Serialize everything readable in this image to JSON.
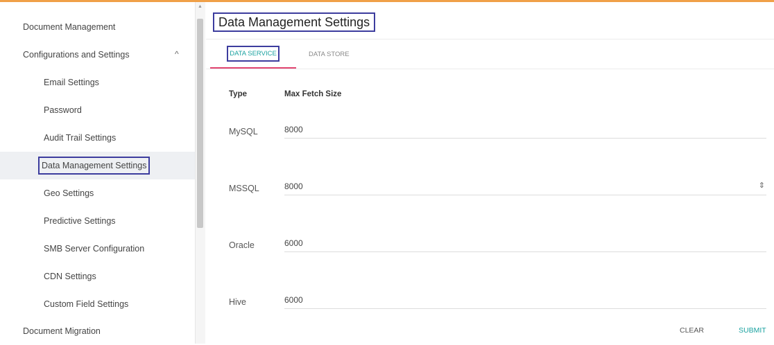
{
  "sidebar": {
    "items": [
      {
        "label": "Document Management"
      },
      {
        "label": "Configurations and Settings"
      },
      {
        "label": "Email Settings"
      },
      {
        "label": "Password"
      },
      {
        "label": "Audit Trail Settings"
      },
      {
        "label": "Data Management Settings"
      },
      {
        "label": "Geo Settings"
      },
      {
        "label": "Predictive Settings"
      },
      {
        "label": "SMB Server Configuration"
      },
      {
        "label": "CDN Settings"
      },
      {
        "label": "Custom Field Settings"
      },
      {
        "label": "Document Migration"
      }
    ],
    "chevron": "^"
  },
  "main": {
    "title": "Data Management Settings",
    "tabs": [
      {
        "label": "DATA SERVICE"
      },
      {
        "label": "DATA STORE"
      }
    ],
    "headers": {
      "type": "Type",
      "max_fetch": "Max Fetch Size"
    },
    "rows": [
      {
        "type": "MySQL",
        "value": "8000"
      },
      {
        "type": "MSSQL",
        "value": "8000"
      },
      {
        "type": "Oracle",
        "value": "6000"
      },
      {
        "type": "Hive",
        "value": "6000"
      }
    ],
    "spinner": "⇕",
    "buttons": {
      "clear": "CLEAR",
      "submit": "SUBMIT"
    }
  },
  "colors": {
    "accent": "#1aa2a0",
    "tab_underline": "#e0436f",
    "highlight_box": "#3c3c9e",
    "top_bar": "#f0a048"
  }
}
